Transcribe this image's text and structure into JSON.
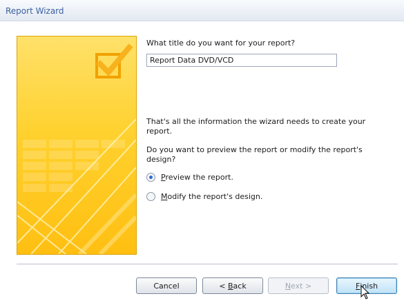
{
  "window": {
    "title": "Report Wizard"
  },
  "icons": {
    "art": "report-wizard-art-icon",
    "checkmark": "checkbox-check-icon",
    "cursor": "mouse-pointer-icon"
  },
  "colors": {
    "accent": "#3b5fa0",
    "art_yellow": "#ffd12e",
    "radio_dot": "#2d6bd4"
  },
  "form": {
    "question": "What title do you want for your report?",
    "title_value": "Report Data DVD/VCD",
    "info": "That's all the information the wizard needs to create your report.",
    "prompt": "Do you want to preview the report or modify the report's design?",
    "options": [
      {
        "mnemonic": "P",
        "rest": "review the report.",
        "selected": true
      },
      {
        "mnemonic": "M",
        "rest": "odify the report's design.",
        "selected": false
      }
    ]
  },
  "buttons": {
    "cancel": "Cancel",
    "back_prefix": "< ",
    "back_mnemonic": "B",
    "back_rest": "ack",
    "next_mnemonic": "N",
    "next_rest": "ext >",
    "finish_mnemonic": "F",
    "finish_rest": "inish"
  }
}
